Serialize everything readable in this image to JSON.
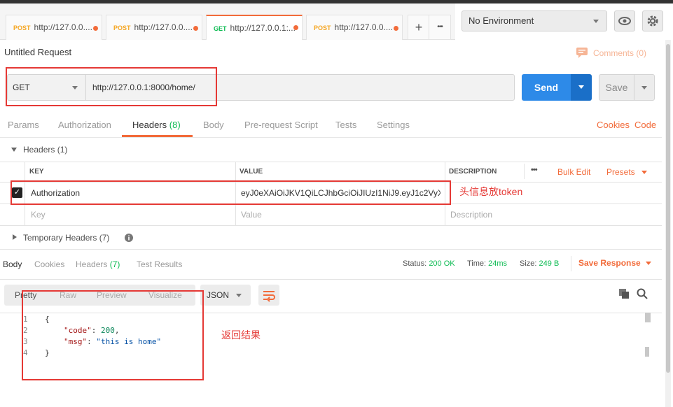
{
  "tabs": [
    {
      "method": "POST",
      "url": "http://127.0.0...."
    },
    {
      "method": "POST",
      "url": "http://127.0.0...."
    },
    {
      "method": "GET",
      "url": "http://127.0.0.1:..."
    },
    {
      "method": "POST",
      "url": "http://127.0.0...."
    }
  ],
  "tab_actions": {
    "new": "+",
    "more": "•••"
  },
  "environment": {
    "selected": "No Environment"
  },
  "request": {
    "title": "Untitled Request",
    "comments": "Comments (0)",
    "method": "GET",
    "url": "http://127.0.0.1:8000/home/",
    "send": "Send",
    "save": "Save"
  },
  "request_tabs": [
    {
      "label": "Params"
    },
    {
      "label": "Authorization"
    },
    {
      "label": "Headers",
      "badge": "(8)"
    },
    {
      "label": "Body"
    },
    {
      "label": "Pre-request Script"
    },
    {
      "label": "Tests"
    },
    {
      "label": "Settings"
    }
  ],
  "request_links": {
    "cookies": "Cookies",
    "code": "Code"
  },
  "headers_section": {
    "title": "Headers",
    "count": "(1)",
    "columns": {
      "key": "KEY",
      "value": "VALUE",
      "description": "DESCRIPTION"
    },
    "more": "•••",
    "bulk_edit": "Bulk Edit",
    "presets": "Presets",
    "rows": [
      {
        "checked": true,
        "key": "Authorization",
        "value": "eyJ0eXAiOiJKV1QiLCJhbGciOiJIUzI1NiJ9.eyJ1c2VyX..."
      }
    ],
    "placeholders": {
      "key": "Key",
      "value": "Value",
      "description": "Description"
    }
  },
  "temporary_headers": {
    "title": "Temporary Headers",
    "count": "(7)"
  },
  "response_tabs": [
    {
      "label": "Body"
    },
    {
      "label": "Cookies"
    },
    {
      "label": "Headers",
      "badge": "(7)"
    },
    {
      "label": "Test Results"
    }
  ],
  "response_status": {
    "status_label": "Status:",
    "status": "200 OK",
    "time_label": "Time:",
    "time": "24ms",
    "size_label": "Size:",
    "size": "249 B",
    "save_response": "Save Response"
  },
  "view_modes": [
    "Pretty",
    "Raw",
    "Preview",
    "Visualize"
  ],
  "format": "JSON",
  "response_code": {
    "line_numbers": [
      "1",
      "2",
      "3",
      "4"
    ],
    "open": "{",
    "code_key": "\"code\"",
    "code_value": "200",
    "msg_key": "\"msg\"",
    "msg_value": "\"this is home\"",
    "close": "}"
  },
  "annotations": {
    "header_note": "头信息放token",
    "result_note": "返回结果"
  },
  "colors": {
    "accent": "#f26b3a",
    "send": "#2d8ae8",
    "success": "#0cbb52",
    "annotation": "#e53935"
  }
}
